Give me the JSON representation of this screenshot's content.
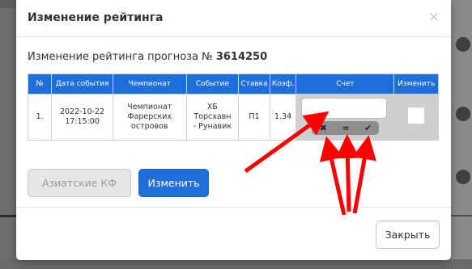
{
  "modal": {
    "title": "Изменение рейтинга",
    "close_glyph": "×",
    "subtitle_prefix": "Изменение рейтинга прогноза № ",
    "forecast_number": "3614250"
  },
  "table": {
    "headers": [
      "№",
      "Дата события",
      "Чемпионат",
      "Событие",
      "Ставка",
      "Коэф.",
      "Счет",
      "Изменить"
    ],
    "row": {
      "num": "1.",
      "date": "2022-10-22",
      "time": "17:15:00",
      "championship_line1": "Чемпионат",
      "championship_line2": "Фарерских",
      "championship_line3": "островов",
      "event_line1": "ХБ Торсхавн",
      "event_line2": "- Рунавик",
      "bet": "П1",
      "odds": "1.34",
      "score_value": "",
      "score_buttons": [
        "✖",
        "=",
        "✔"
      ]
    }
  },
  "buttons": {
    "asian": "Азиатские КФ",
    "change": "Изменить",
    "close": "Закрыть"
  },
  "colors": {
    "accent": "#1e6fd9",
    "annotation_arrows": "#ff0000"
  }
}
